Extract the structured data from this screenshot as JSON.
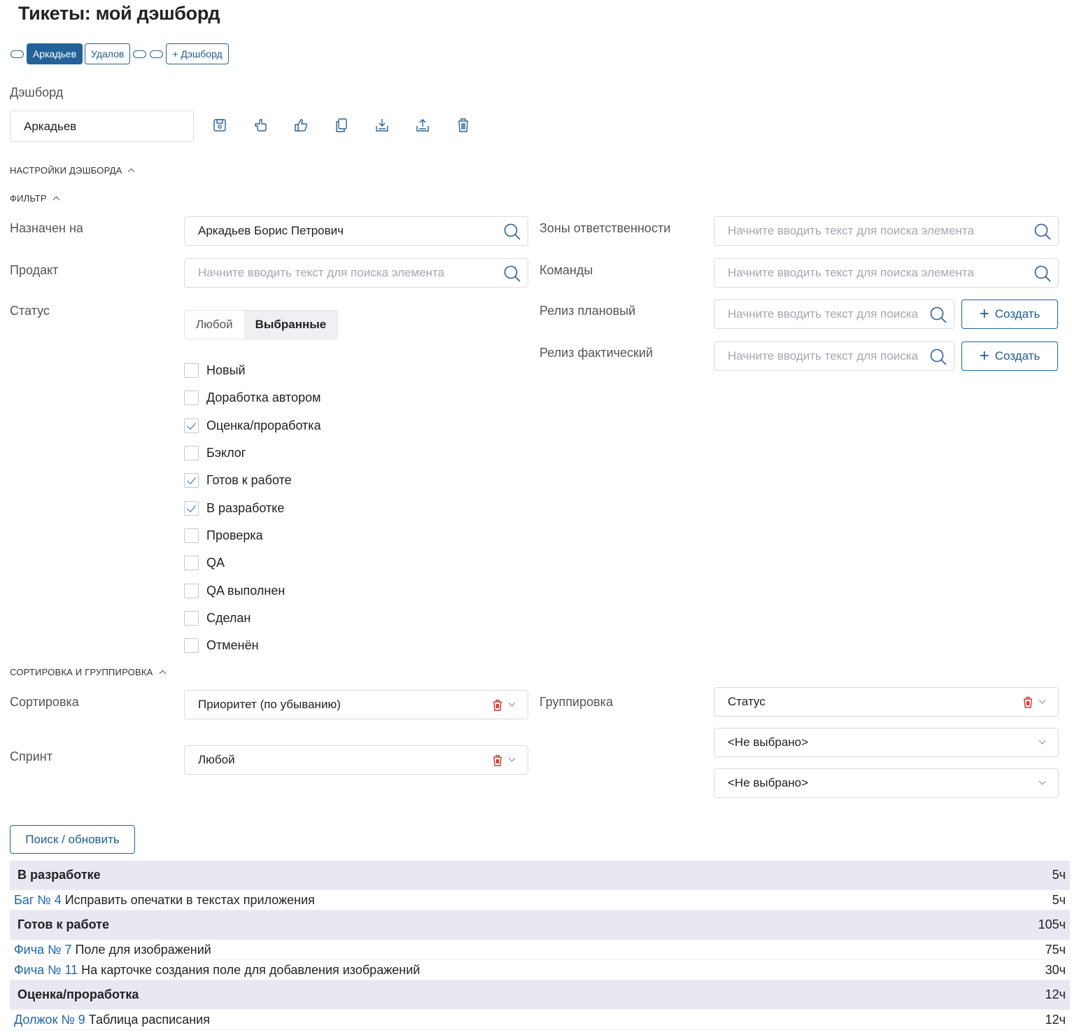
{
  "page_title": "Тикеты: мой дэшборд",
  "tabs": [
    {
      "label": "Аркадьев",
      "active": true
    },
    {
      "label": "Удалов",
      "active": false
    }
  ],
  "add_dashboard_label": "+ Дэшборд",
  "dashboard": {
    "label": "Дэшборд",
    "value": "Аркадьев"
  },
  "toolbar_icons": [
    "save-icon",
    "hand-pointing-icon",
    "thumbs-up-icon",
    "copy-icon",
    "download-icon",
    "upload-icon",
    "trash-icon"
  ],
  "sections": {
    "dashboard_settings": "НАСТРОЙКИ ДЭШБОРДА",
    "filter": "ФИЛЬТР",
    "sort_group": "СОРТИРОВКА И ГРУППИРОВКА"
  },
  "filter": {
    "assigned": {
      "label": "Назначен на",
      "value": "Аркадьев Борис Петрович"
    },
    "product": {
      "label": "Продакт",
      "placeholder": "Начните вводить текст для поиска элемента"
    },
    "zones": {
      "label": "Зоны ответственности",
      "placeholder": "Начните вводить текст для поиска элемента"
    },
    "teams": {
      "label": "Команды",
      "placeholder": "Начните вводить текст для поиска элемента"
    },
    "release_planned": {
      "label": "Релиз плановый",
      "placeholder": "Начните вводить текст для поиска"
    },
    "release_actual": {
      "label": "Релиз фактический",
      "placeholder": "Начните вводить текст для поиска"
    },
    "create_label": "Создать",
    "status": {
      "label": "Статус",
      "seg_any": "Любой",
      "seg_selected": "Выбранные",
      "options": [
        {
          "label": "Новый",
          "checked": false
        },
        {
          "label": "Доработка автором",
          "checked": false
        },
        {
          "label": "Оценка/проработка",
          "checked": true
        },
        {
          "label": "Бэклог",
          "checked": false
        },
        {
          "label": "Готов к работе",
          "checked": true
        },
        {
          "label": "В разработке",
          "checked": true
        },
        {
          "label": "Проверка",
          "checked": false
        },
        {
          "label": "QA",
          "checked": false
        },
        {
          "label": "QA выполнен",
          "checked": false
        },
        {
          "label": "Сделан",
          "checked": false
        },
        {
          "label": "Отменён",
          "checked": false
        }
      ]
    }
  },
  "sorting": {
    "sort_label": "Сортировка",
    "sort_value": "Приоритет (по убыванию)",
    "sprint_label": "Спринт",
    "sprint_value": "Любой",
    "group_label": "Группировка",
    "group_values": [
      "Статус",
      "<Не выбрано>",
      "<Не выбрано>"
    ]
  },
  "search_button": "Поиск / обновить",
  "results": [
    {
      "type": "group",
      "title": "В разработке",
      "hours": "5ч"
    },
    {
      "type": "item",
      "link": "Баг № 4",
      "title": "Исправить опечатки в текстах приложения",
      "hours": "5ч"
    },
    {
      "type": "group",
      "title": "Готов к работе",
      "hours": "105ч"
    },
    {
      "type": "item",
      "link": "Фича № 7",
      "title": "Поле для изображений",
      "hours": "75ч"
    },
    {
      "type": "item",
      "link": "Фича № 11",
      "title": "На карточке создания поле для добавления изображений",
      "hours": "30ч"
    },
    {
      "type": "group",
      "title": "Оценка/проработка",
      "hours": "12ч"
    },
    {
      "type": "item",
      "link": "Должок № 9",
      "title": "Таблица расписания",
      "hours": "12ч"
    }
  ],
  "colors": {
    "accent": "#22629a",
    "link": "#1e66ac",
    "group_bg": "#e7e8f2",
    "danger": "#d0312d"
  }
}
